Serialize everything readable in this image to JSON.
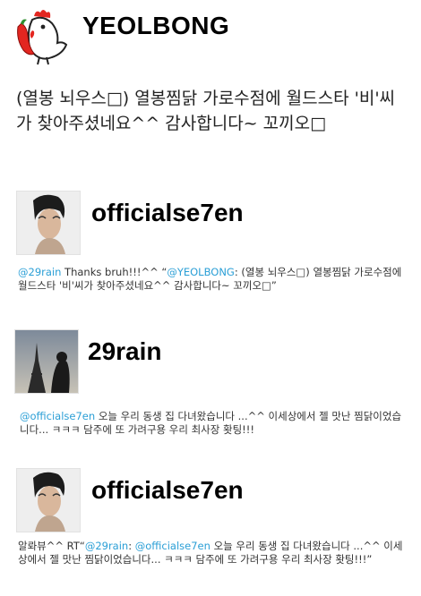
{
  "tweet1": {
    "username": "YEOLBONG",
    "text": "(열봉 뇌우스□) 열봉찜닭 가로수점에 월드스타 '비'씨가 찾아주셨네요^^ 감사합니다~ 꼬끼오□"
  },
  "tweet2": {
    "username": "officialse7en",
    "mention1": "@29rain",
    "text_a": " Thanks bruh!!!^^ “",
    "mention2": "@YEOLBONG",
    "text_b": ": (열봉 뇌우스□) 열봉찜닭 가로수점에 월드스타 '비'씨가 찾아주셨네요^^ 감사합니다~ 꼬끼오□”"
  },
  "tweet3": {
    "username": "29rain",
    "mention1": "@officialse7en",
    "text_a": " 오늘 우리 동생 집 다녀왔습니다 ...^^ 이세상에서 젤 맛난 찜닭이었습니다... ㅋㅋㅋ 담주에 또 가려구용 우리 최사장 홧팅!!!"
  },
  "tweet4": {
    "username": "officialse7en",
    "text_a": "알롸뷰^^ RT“",
    "mention1": "@29rain",
    "text_b": ": ",
    "mention2": "@officialse7en",
    "text_c": " 오늘 우리 동생 집 다녀왔습니다 ...^^ 이세상에서 젤 맛난 찜닭이었습니다... ㅋㅋㅋ 담주에 또 가려구용 우리 최사장 홧팅!!!”"
  },
  "colors": {
    "mention": "#2b9fd6",
    "text": "#333333",
    "username": "#000000"
  },
  "icons": [
    "rooster-logo-icon",
    "avatar-photo"
  ]
}
